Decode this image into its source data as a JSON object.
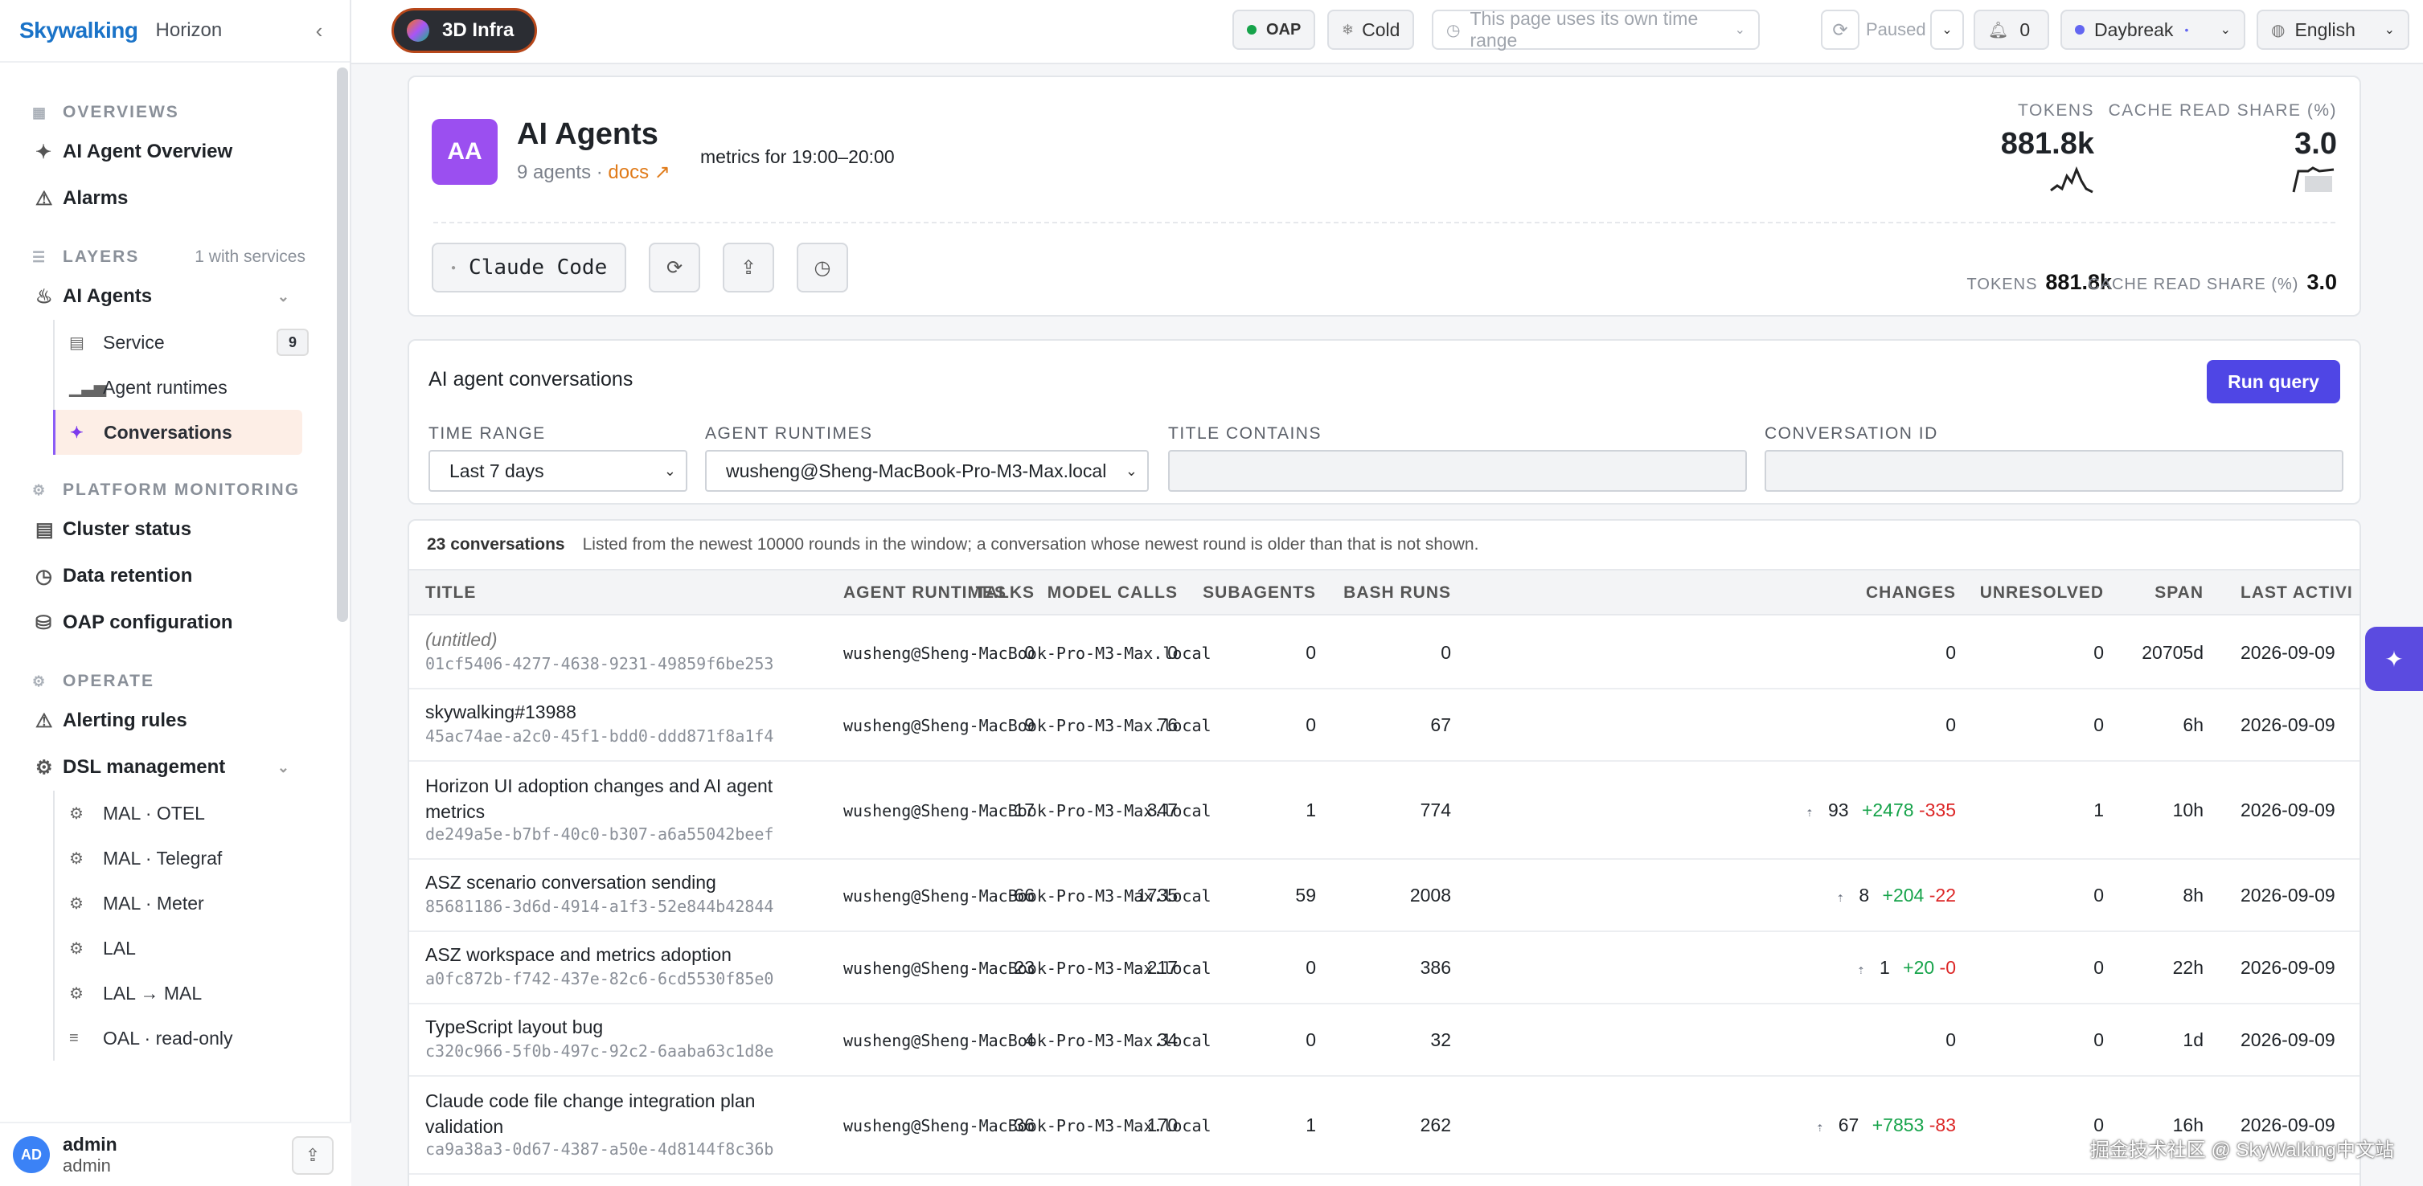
{
  "app": {
    "brand": "Skywalking",
    "product": "Horizon"
  },
  "sidebar": {
    "overviews": {
      "title": "OVERVIEWS",
      "items": [
        "AI Agent Overview",
        "Alarms"
      ]
    },
    "layers": {
      "title": "LAYERS",
      "meta": "1 with services",
      "ai_agents": "AI Agents",
      "subitems": [
        "Service",
        "Agent runtimes",
        "Conversations"
      ],
      "service_count": "9"
    },
    "platform": {
      "title": "PLATFORM MONITORING",
      "items": [
        "Cluster status",
        "Data retention",
        "OAP configuration"
      ]
    },
    "operate": {
      "title": "OPERATE",
      "items": [
        "Alerting rules",
        "DSL management"
      ],
      "dsl_items": [
        "MAL · OTEL",
        "MAL · Telegraf",
        "MAL · Meter",
        "LAL",
        "LAL → MAL",
        "OAL · read-only"
      ]
    },
    "user": {
      "initials": "AD",
      "name": "admin",
      "role": "admin"
    }
  },
  "topbar": {
    "infra": "3D Infra",
    "oap": "OAP",
    "cold": "Cold",
    "time_range": "This page uses its own time range",
    "paused": "Paused",
    "alerts": "0",
    "theme": "Daybreak",
    "language": "English",
    "colors": {
      "oap_dot": "#16a34a",
      "theme_dot": "#6366f1"
    }
  },
  "header": {
    "initials": "AA",
    "title": "AI Agents",
    "agents": "9 agents ·",
    "docs": "docs ↗",
    "metrics": "metrics for 19:00–20:00",
    "stats": [
      {
        "label": "TOKENS",
        "value": "881.8k"
      },
      {
        "label": "CACHE READ SHARE (%)",
        "value": "3.0"
      }
    ],
    "service": "Claude Code",
    "inline_stats": [
      {
        "label": "TOKENS",
        "value": "881.8k"
      },
      {
        "label": "CACHE READ SHARE (%)",
        "value": "3.0"
      }
    ]
  },
  "filters": {
    "title": "AI agent conversations",
    "run": "Run query",
    "time_range_label": "TIME RANGE",
    "time_range_value": "Last 7 days",
    "runtimes_label": "AGENT RUNTIMES",
    "runtimes_value": "wusheng@Sheng-MacBook-Pro-M3-Max.local",
    "title_label": "TITLE CONTAINS",
    "conv_label": "CONVERSATION ID"
  },
  "table": {
    "count": "23 conversations",
    "note": "Listed from the newest 10000 rounds in the window; a conversation whose newest round is older than that is not shown.",
    "columns": [
      "TITLE",
      "AGENT RUNTIMES",
      "TALKS",
      "MODEL CALLS",
      "SUBAGENTS",
      "BASH RUNS",
      "CHANGES",
      "UNRESOLVED",
      "SPAN",
      "LAST ACTIVI"
    ],
    "rows": [
      {
        "title": "(untitled)",
        "id": "01cf5406-4277-4638-9231-49859f6be253",
        "runtime": "wusheng@Sheng-MacBook-Pro-M3-Max.local",
        "talks": "0",
        "calls": "0",
        "sub": "0",
        "bash": "0",
        "changes": "0",
        "add": "",
        "del": "",
        "unres": "0",
        "span": "20705d",
        "last": "2026-09-09"
      },
      {
        "title": "skywalking#13988",
        "id": "45ac74ae-a2c0-45f1-bdd0-ddd871f8a1f4",
        "runtime": "wusheng@Sheng-MacBook-Pro-M3-Max.local",
        "talks": "9",
        "calls": "76",
        "sub": "0",
        "bash": "67",
        "changes": "0",
        "add": "",
        "del": "",
        "unres": "0",
        "span": "6h",
        "last": "2026-09-09"
      },
      {
        "title": "Horizon UI adoption changes and AI agent metrics",
        "id": "de249a5e-b7bf-40c0-b307-a6a55042beef",
        "runtime": "wusheng@Sheng-MacBook-Pro-M3-Max.local",
        "talks": "17",
        "calls": "347",
        "sub": "1",
        "bash": "774",
        "changes": "93",
        "add": "+2478",
        "del": "-335",
        "unres": "1",
        "span": "10h",
        "last": "2026-09-09"
      },
      {
        "title": "ASZ scenario conversation sending",
        "id": "85681186-3d6d-4914-a1f3-52e844b42844",
        "runtime": "wusheng@Sheng-MacBook-Pro-M3-Max.local",
        "talks": "66",
        "calls": "1735",
        "sub": "59",
        "bash": "2008",
        "changes": "8",
        "add": "+204",
        "del": "-22",
        "unres": "0",
        "span": "8h",
        "last": "2026-09-09"
      },
      {
        "title": "ASZ workspace and metrics adoption",
        "id": "a0fc872b-f742-437e-82c6-6cd5530f85e0",
        "runtime": "wusheng@Sheng-MacBook-Pro-M3-Max.local",
        "talks": "23",
        "calls": "217",
        "sub": "0",
        "bash": "386",
        "changes": "1",
        "add": "+20",
        "del": "-0",
        "unres": "0",
        "span": "22h",
        "last": "2026-09-09"
      },
      {
        "title": "TypeScript layout bug",
        "id": "c320c966-5f0b-497c-92c2-6aaba63c1d8e",
        "runtime": "wusheng@Sheng-MacBook-Pro-M3-Max.local",
        "talks": "4",
        "calls": "34",
        "sub": "0",
        "bash": "32",
        "changes": "0",
        "add": "",
        "del": "",
        "unres": "0",
        "span": "1d",
        "last": "2026-09-09"
      },
      {
        "title": "Claude code file change integration plan validation",
        "id": "ca9a38a3-0d67-4387-a50e-4d8144f8c36b",
        "runtime": "wusheng@Sheng-MacBook-Pro-M3-Max.local",
        "talks": "36",
        "calls": "170",
        "sub": "1",
        "bash": "262",
        "changes": "67",
        "add": "+7853",
        "del": "-83",
        "unres": "0",
        "span": "16h",
        "last": "2026-09-09"
      }
    ]
  },
  "watermark": "掘金技术社区 @ SkyWalking中文站"
}
